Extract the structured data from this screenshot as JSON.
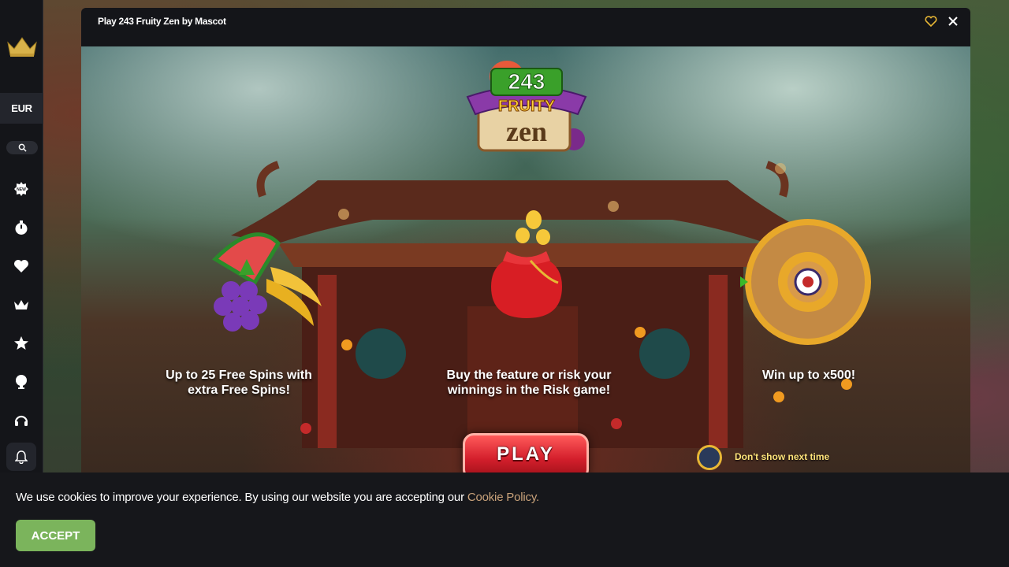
{
  "sidebar": {
    "currency": "EUR",
    "icons": [
      "crown-logo-icon",
      "search-icon",
      "new-badge-icon",
      "stopwatch-icon",
      "heart-icon",
      "crown-icon",
      "star-icon",
      "trophy-icon",
      "headset-icon",
      "bell-icon"
    ]
  },
  "modal": {
    "title": "Play 243 Fruity Zen by Mascot"
  },
  "game": {
    "logo_number": "243",
    "logo_word1": "FRUITY",
    "logo_word2": "zen",
    "features": [
      {
        "line1": "Up to 25 Free Spins with",
        "line2": "extra Free Spins!"
      },
      {
        "line1": "Buy the feature or risk your",
        "line2": "winnings in the Risk game!"
      },
      {
        "line1": "Win up to x500!",
        "line2": ""
      }
    ],
    "play_label": "PLAY",
    "dont_show_label": "Don't show next time"
  },
  "cookie": {
    "text": "We use cookies to improve your experience. By using our website you are accepting our ",
    "link": "Cookie Policy.",
    "accept_label": "ACCEPT"
  },
  "colors": {
    "sidebar_bg": "#141519",
    "accept_green": "#7bb45c",
    "cookie_link": "#c9a27a",
    "play_red": "#d41f2c",
    "gold": "#e8b735"
  }
}
